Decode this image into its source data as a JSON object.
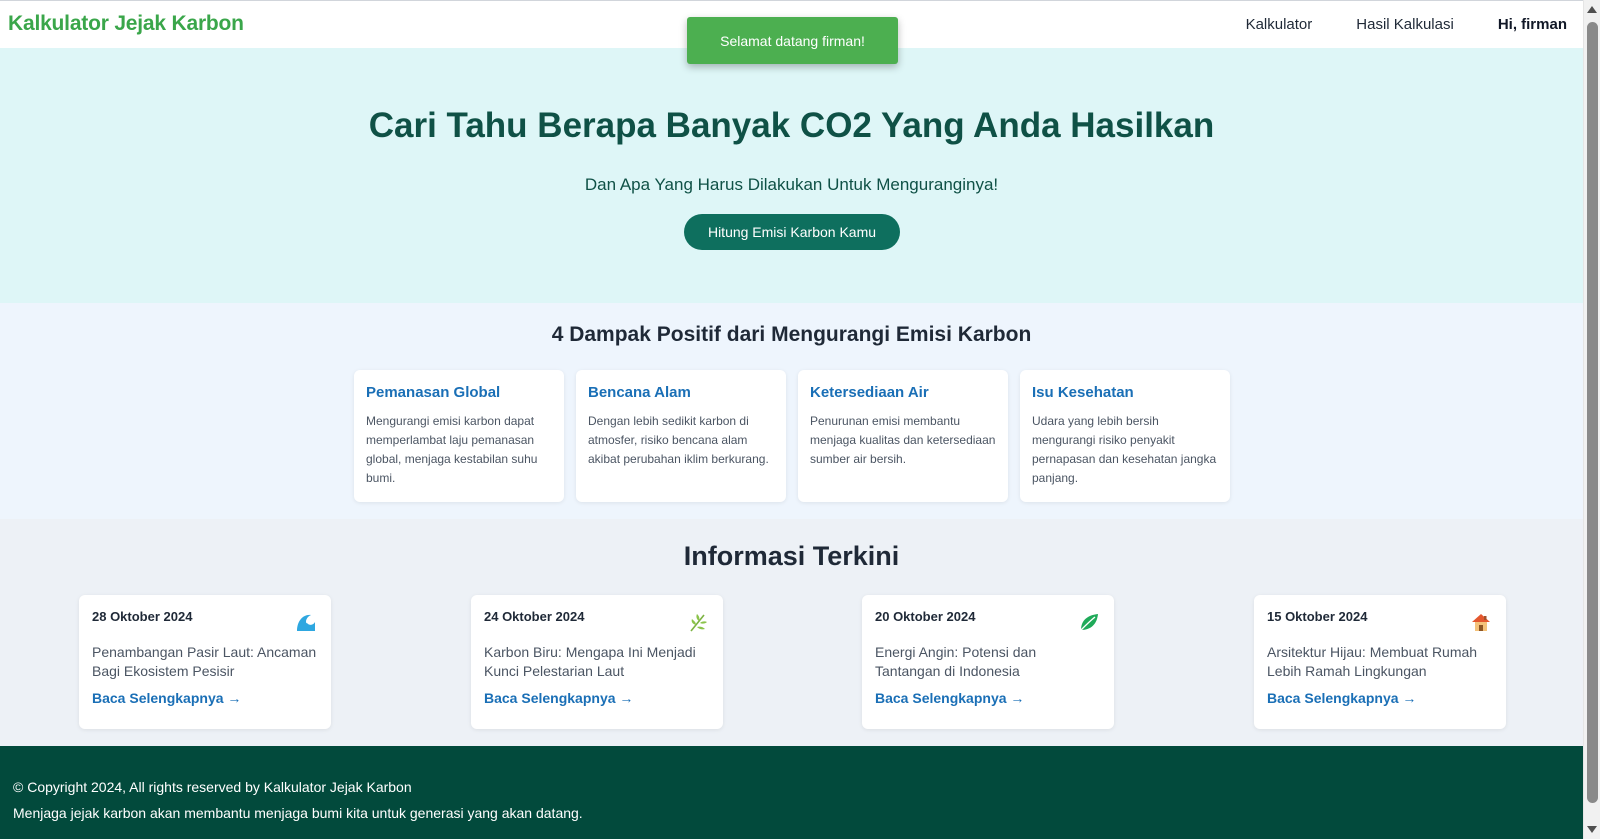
{
  "navbar": {
    "brand": "Kalkulator Jejak Karbon",
    "links": [
      "Kalkulator",
      "Hasil Kalkulasi"
    ],
    "user_greeting": "Hi, firman"
  },
  "toast": {
    "message": "Selamat datang firman!"
  },
  "hero": {
    "title": "Cari Tahu Berapa Banyak CO2 Yang Anda Hasilkan",
    "subtitle": "Dan Apa Yang Harus Dilakukan Untuk Menguranginya!",
    "cta_label": "Hitung Emisi Karbon Kamu"
  },
  "impacts": {
    "title": "4 Dampak Positif dari Mengurangi Emisi Karbon",
    "cards": [
      {
        "title": "Pemanasan Global",
        "text": "Mengurangi emisi karbon dapat memperlambat laju pemanasan global, menjaga kestabilan suhu bumi."
      },
      {
        "title": "Bencana Alam",
        "text": "Dengan lebih sedikit karbon di atmosfer, risiko bencana alam akibat perubahan iklim berkurang."
      },
      {
        "title": "Ketersediaan Air",
        "text": "Penurunan emisi membantu menjaga kualitas dan ketersediaan sumber air bersih."
      },
      {
        "title": "Isu Kesehatan",
        "text": "Udara yang lebih bersih mengurangi risiko penyakit pernapasan dan kesehatan jangka panjang."
      }
    ]
  },
  "news": {
    "title": "Informasi Terkini",
    "read_more": "Baca Selengkapnya →",
    "items": [
      {
        "date": "28 Oktober 2024",
        "headline": "Penambangan Pasir Laut: Ancaman Bagi Ekosistem Pesisir",
        "icon": "wave-icon"
      },
      {
        "date": "24 Oktober 2024",
        "headline": "Karbon Biru: Mengapa Ini Menjadi Kunci Pelestarian Laut",
        "icon": "herb-icon"
      },
      {
        "date": "20 Oktober 2024",
        "headline": "Energi Angin: Potensi dan Tantangan di Indonesia",
        "icon": "leaf-icon"
      },
      {
        "date": "15 Oktober 2024",
        "headline": "Arsitektur Hijau: Membuat Rumah Lebih Ramah Lingkungan",
        "icon": "house-icon"
      }
    ]
  },
  "footer": {
    "copyright": "© Copyright 2024, All rights reserved by Kalkulator Jejak Karbon",
    "tagline": "Menjaga jejak karbon akan membantu menjaga bumi kita untuk generasi yang akan datang."
  },
  "colors": {
    "brand_green": "#3aa64a",
    "toast_green": "#4caf50",
    "hero_bg": "#def6f7",
    "primary_teal": "#0e6f5e",
    "link_blue": "#1a6fb6",
    "footer_bg": "#024a3c"
  }
}
